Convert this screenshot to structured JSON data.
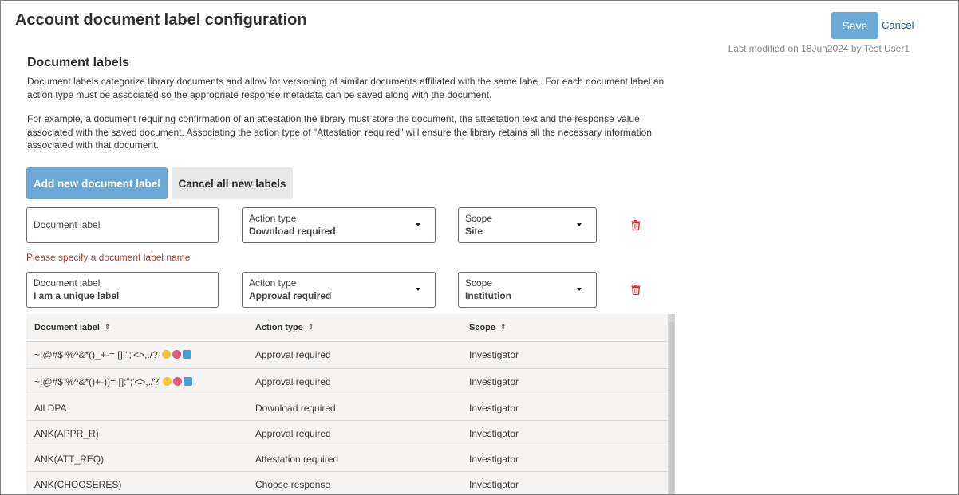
{
  "header": {
    "title": "Account document label configuration",
    "save_label": "Save",
    "cancel_label": "Cancel",
    "last_modified": "Last modified on 18Jun2024 by Test User1"
  },
  "section": {
    "title": "Document labels",
    "description_1": "Document labels categorize library documents and allow for versioning of similar documents affiliated with the same label. For each document label an action type must be associated so the appropriate response metadata can be saved along with the document.",
    "description_2": "For example, a document requiring confirmation of an attestation the library must store the document, the attestation text and the response value associated with the saved document. Associating the action type of \"Attestation required\" will ensure the library retains all the necessary information associated with that document."
  },
  "actions": {
    "add_label": "Add new document label",
    "cancel_all_label": "Cancel all new labels"
  },
  "new_rows": [
    {
      "label_field": {
        "label": "Document label",
        "value": ""
      },
      "action_field": {
        "label": "Action type",
        "value": "Download required"
      },
      "scope_field": {
        "label": "Scope",
        "value": "Site"
      },
      "error": "Please specify a document label name"
    },
    {
      "label_field": {
        "label": "Document label",
        "value": "I am a unique label"
      },
      "action_field": {
        "label": "Action type",
        "value": "Approval required"
      },
      "scope_field": {
        "label": "Scope",
        "value": "Institution"
      }
    }
  ],
  "table": {
    "columns": [
      "Document label",
      "Action type",
      "Scope"
    ],
    "rows": [
      {
        "label": "~!@#$ %^&*()_+-= []:\";'<>,./?",
        "action": "Approval required",
        "scope": "Investigator",
        "emojis": true
      },
      {
        "label": "~!@#$ %^&*()+-))= []:\";'<>,./?",
        "action": "Approval required",
        "scope": "Investigator",
        "emojis": true
      },
      {
        "label": "All DPA",
        "action": "Download required",
        "scope": "Investigator"
      },
      {
        "label": "ANK(APPR_R)",
        "action": "Approval required",
        "scope": "Investigator"
      },
      {
        "label": "ANK(ATT_REQ)",
        "action": "Attestation required",
        "scope": "Investigator"
      },
      {
        "label": "ANK(CHOOSERES)",
        "action": "Choose response",
        "scope": "Investigator"
      }
    ]
  },
  "colors": {
    "primary": "#6aa8d8",
    "error": "#b0413e",
    "delete": "#d0352f"
  }
}
